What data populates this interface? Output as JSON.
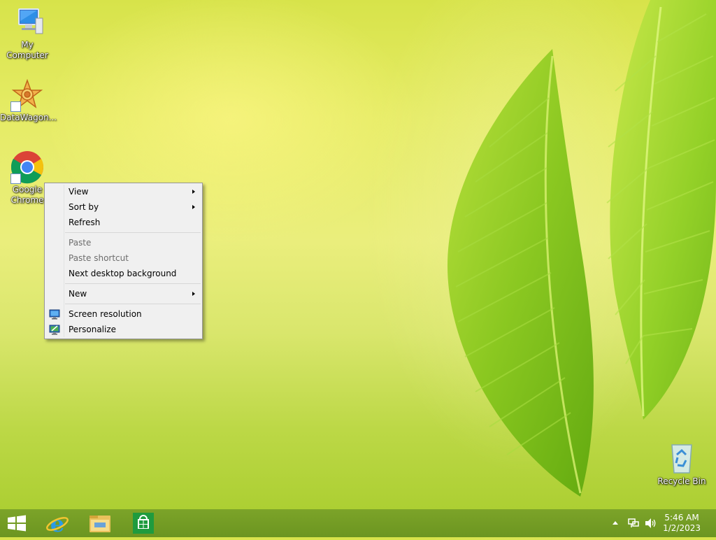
{
  "desktop": {
    "icons": [
      {
        "label": "My Computer"
      },
      {
        "label": "DataWagon..."
      },
      {
        "label": "Google\nChrome"
      },
      {
        "label": "Recycle Bin"
      }
    ]
  },
  "context_menu": {
    "items": [
      {
        "label": "View",
        "submenu": true
      },
      {
        "label": "Sort by",
        "submenu": true
      },
      {
        "label": "Refresh"
      },
      {
        "label": "Paste",
        "disabled": true
      },
      {
        "label": "Paste shortcut",
        "disabled": true
      },
      {
        "label": "Next desktop background"
      },
      {
        "label": "New",
        "submenu": true
      },
      {
        "label": "Screen resolution",
        "icon": "display-icon"
      },
      {
        "label": "Personalize",
        "icon": "personalize-icon"
      }
    ]
  },
  "taskbar": {
    "apps": [
      {
        "name": "start-icon"
      },
      {
        "name": "internet-explorer-icon"
      },
      {
        "name": "file-explorer-icon"
      },
      {
        "name": "store-icon"
      }
    ],
    "tray": {
      "time": "5:46 AM",
      "date": "1/2/2023",
      "icons": [
        "show-hidden-icons-icon",
        "network-icon",
        "volume-icon"
      ]
    }
  }
}
